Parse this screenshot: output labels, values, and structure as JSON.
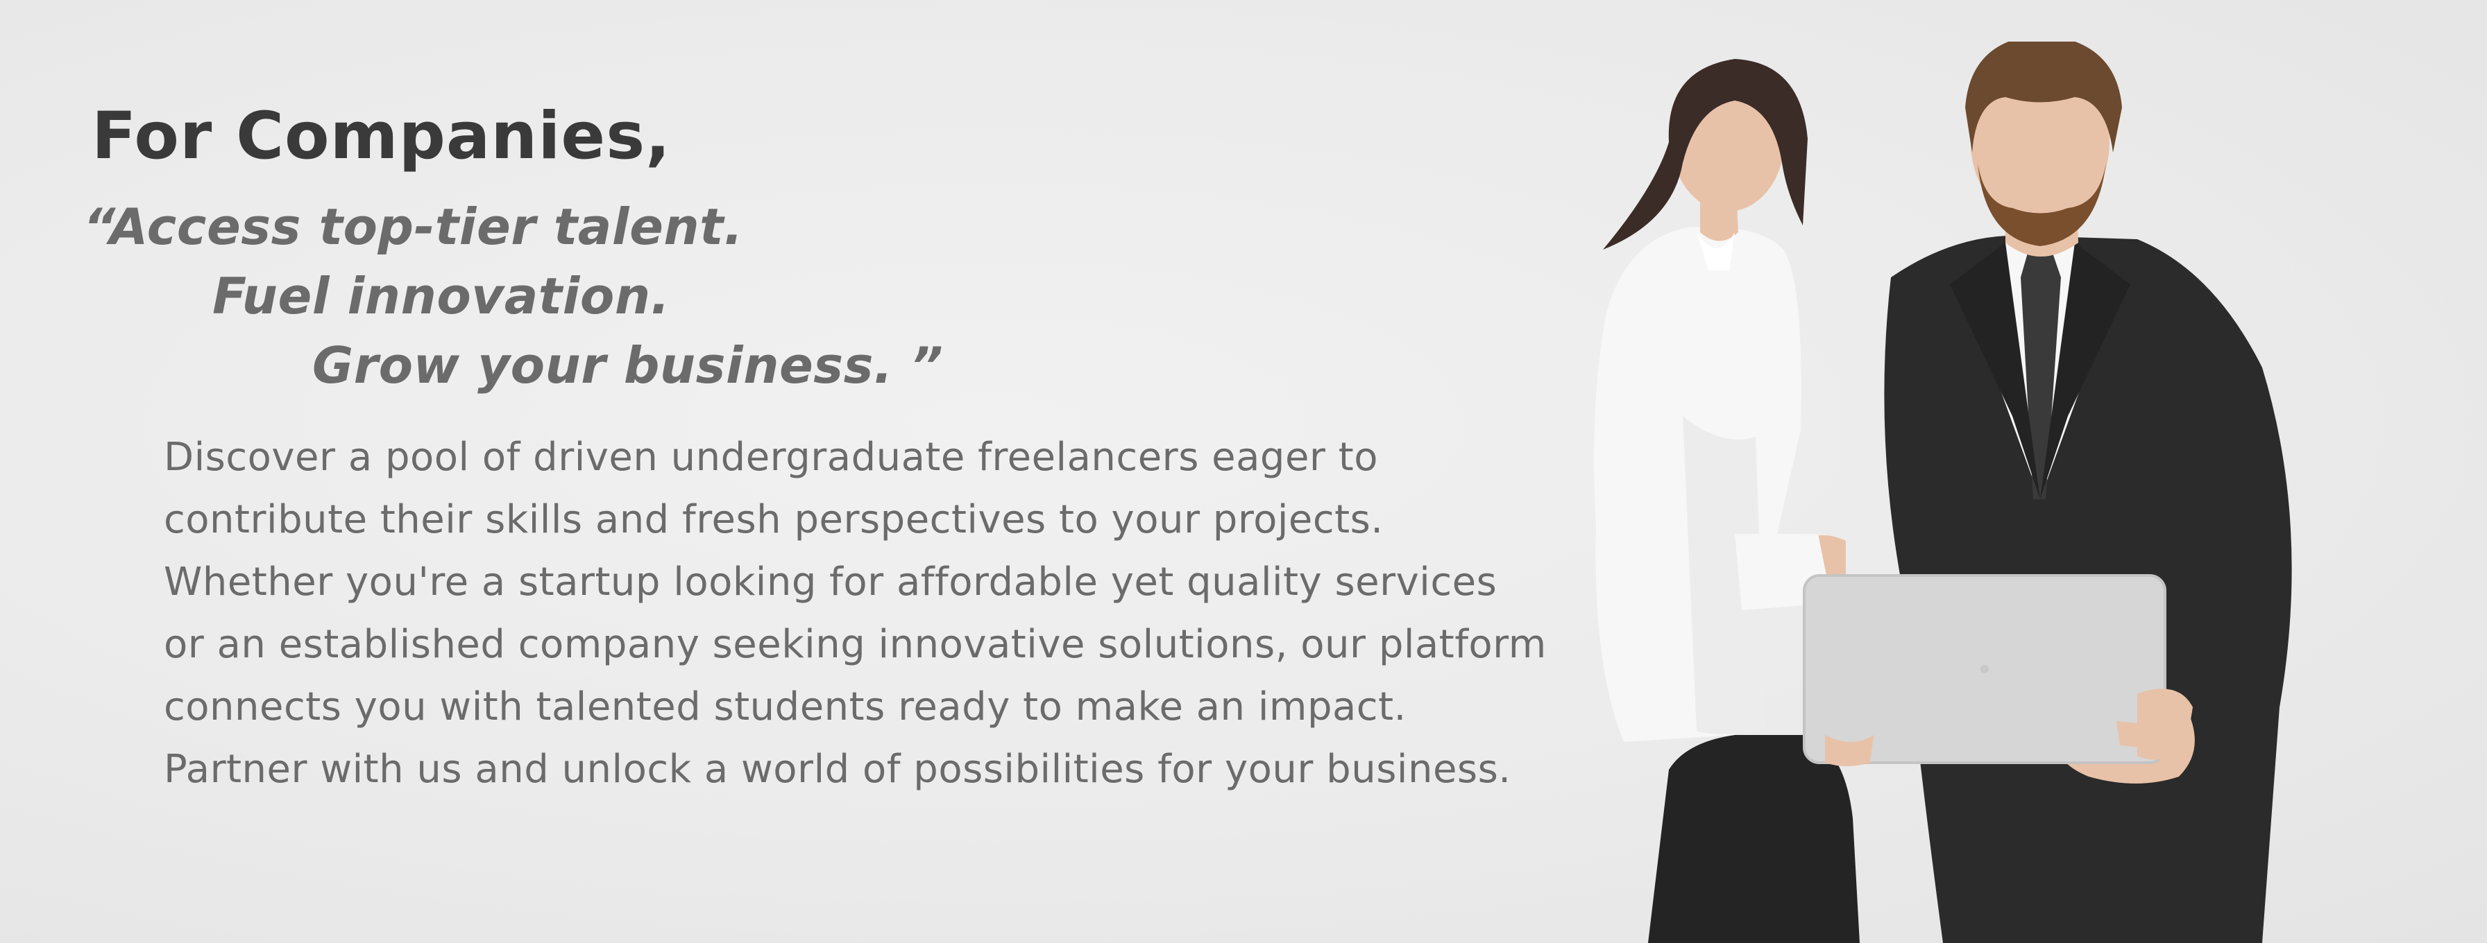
{
  "hero": {
    "heading": "For Companies,",
    "quote": {
      "open_mark": "“",
      "line1": "Access top-tier talent.",
      "line2": "Fuel innovation.",
      "line3": "Grow your business.",
      "close_mark": "”"
    },
    "body_lines": [
      "Discover a pool of driven undergraduate freelancers eager to",
      "contribute their skills and fresh perspectives to your projects.",
      "Whether you're a startup looking for affordable yet quality services",
      "or an established company seeking innovative solutions, our platform",
      "connects you with talented students ready to make an impact.",
      "Partner with us and unlock a world of possibilities for your business."
    ]
  },
  "photo": {
    "icon": "business-people-laptop-photo",
    "colors": {
      "suit": "#2b2b2b",
      "shirt_white": "#f7f7f7",
      "laptop": "#d6d6d6",
      "hair_woman": "#3b2c28",
      "hair_man": "#6b4a2f",
      "skin": "#e8c2a8"
    }
  }
}
